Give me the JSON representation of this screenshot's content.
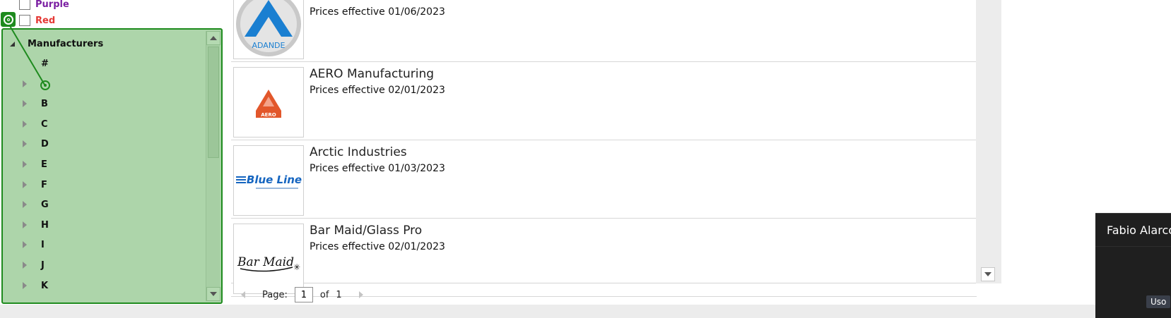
{
  "colors": [
    {
      "label": "Purple",
      "color": "#7b1fa2"
    },
    {
      "label": "Red",
      "color": "#e53935"
    }
  ],
  "tree": {
    "root_label": "Manufacturers",
    "letters": [
      "#",
      "",
      "B",
      "C",
      "D",
      "E",
      "F",
      "G",
      "H",
      "I",
      "J",
      "K"
    ]
  },
  "manufacturers": [
    {
      "name": "",
      "prices": "Prices effective 01/06/2023",
      "logo": "ADANDE",
      "logo_icon": "adande-logo-icon"
    },
    {
      "name": "AERO Manufacturing",
      "prices": "Prices effective 02/01/2023",
      "logo": "AERO",
      "logo_icon": "aero-logo-icon"
    },
    {
      "name": "Arctic Industries",
      "prices": "Prices effective 01/03/2023",
      "logo": "Blue Line",
      "logo_icon": "blue-line-logo-icon"
    },
    {
      "name": "Bar Maid/Glass Pro",
      "prices": "Prices effective 02/01/2023",
      "logo": "Bar Maid",
      "logo_icon": "bar-maid-logo-icon"
    }
  ],
  "pager": {
    "label": "Page:",
    "current": "1",
    "of_label": "of",
    "total": "1"
  },
  "popup": {
    "title": "Fabio Alarco",
    "chip": "Uso"
  },
  "accent_colors": {
    "highlight_fill": "#add5aa",
    "highlight_border": "#1e8b1e",
    "active_tab": "#2f9be4"
  }
}
